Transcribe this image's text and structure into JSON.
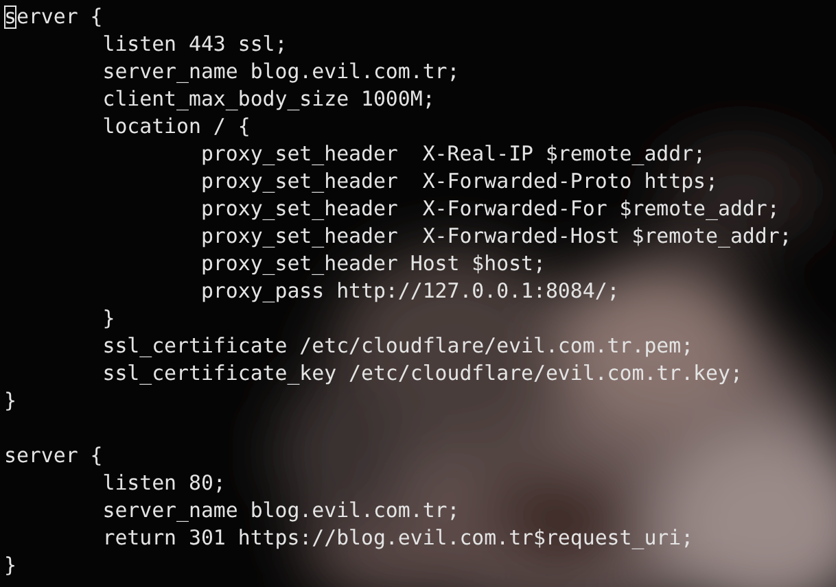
{
  "terminal": {
    "cursor": true,
    "lines": [
      {
        "kind": "code",
        "text": "server {"
      },
      {
        "kind": "code",
        "text": "\tlisten 443 ssl;"
      },
      {
        "kind": "code",
        "text": "\tserver_name blog.evil.com.tr;"
      },
      {
        "kind": "code",
        "text": "\tclient_max_body_size 1000M;"
      },
      {
        "kind": "code",
        "text": "\tlocation / {"
      },
      {
        "kind": "code",
        "text": "\t\tproxy_set_header  X-Real-IP $remote_addr;"
      },
      {
        "kind": "code",
        "text": "\t\tproxy_set_header  X-Forwarded-Proto https;"
      },
      {
        "kind": "code",
        "text": "\t\tproxy_set_header  X-Forwarded-For $remote_addr;"
      },
      {
        "kind": "code",
        "text": "\t\tproxy_set_header  X-Forwarded-Host $remote_addr;"
      },
      {
        "kind": "code",
        "text": "\t\tproxy_set_header Host $host;"
      },
      {
        "kind": "code",
        "text": "\t\tproxy_pass http://127.0.0.1:8084/;"
      },
      {
        "kind": "code",
        "text": "\t}"
      },
      {
        "kind": "code",
        "text": "\tssl_certificate /etc/cloudflare/evil.com.tr.pem;"
      },
      {
        "kind": "code",
        "text": "\tssl_certificate_key /etc/cloudflare/evil.com.tr.key;"
      },
      {
        "kind": "code",
        "text": "}"
      },
      {
        "kind": "blank"
      },
      {
        "kind": "code",
        "text": "server {"
      },
      {
        "kind": "code",
        "text": "\tlisten 80;"
      },
      {
        "kind": "code",
        "text": "\tserver_name blog.evil.com.tr;"
      },
      {
        "kind": "code",
        "text": "\treturn 301 https://blog.evil.com.tr$request_uri;"
      },
      {
        "kind": "code",
        "text": "}"
      }
    ]
  }
}
